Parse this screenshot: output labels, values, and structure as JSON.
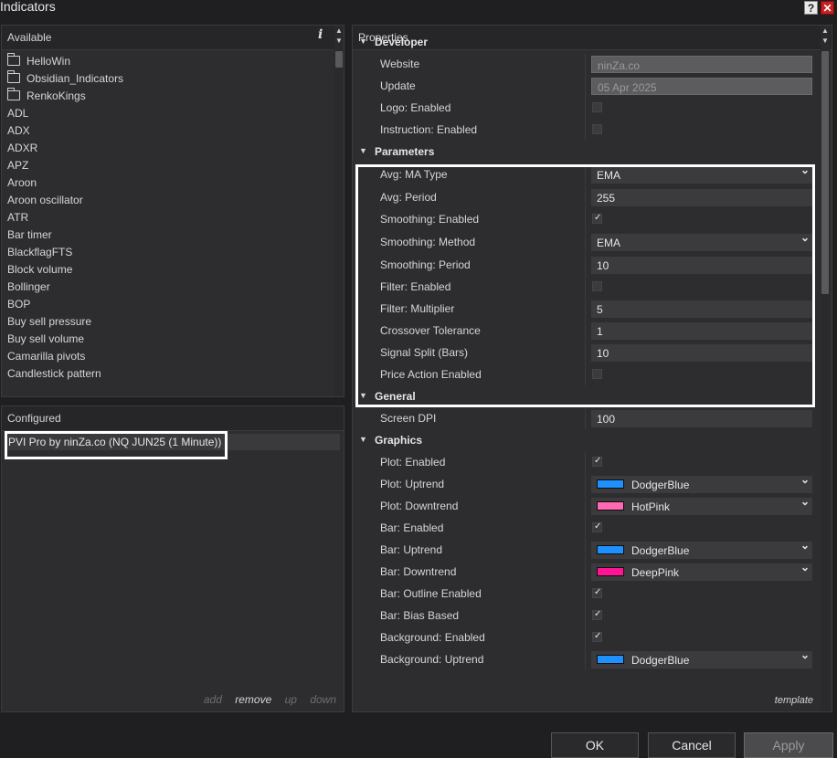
{
  "window": {
    "title": "Indicators",
    "help": "?",
    "close": "✕"
  },
  "available": {
    "header": "Available",
    "info_icon": "i",
    "items": [
      {
        "label": "HelloWin",
        "folder": true
      },
      {
        "label": "Obsidian_Indicators",
        "folder": true
      },
      {
        "label": "RenkoKings",
        "folder": true
      },
      {
        "label": "ADL"
      },
      {
        "label": "ADX"
      },
      {
        "label": "ADXR"
      },
      {
        "label": "APZ"
      },
      {
        "label": "Aroon"
      },
      {
        "label": "Aroon oscillator"
      },
      {
        "label": "ATR"
      },
      {
        "label": "Bar timer"
      },
      {
        "label": "BlackflagFTS"
      },
      {
        "label": "Block volume"
      },
      {
        "label": "Bollinger"
      },
      {
        "label": "BOP"
      },
      {
        "label": "Buy sell pressure"
      },
      {
        "label": "Buy sell volume"
      },
      {
        "label": "Camarilla pivots"
      },
      {
        "label": "Candlestick pattern"
      }
    ]
  },
  "configured": {
    "header": "Configured",
    "item": "PVI Pro by ninZa.co (NQ JUN25 (1 Minute))",
    "actions": {
      "add": "add",
      "remove": "remove",
      "up": "up",
      "down": "down"
    }
  },
  "properties": {
    "header": "Properties",
    "template": "template",
    "categories": {
      "developer": "Developer",
      "parameters": "Parameters",
      "general": "General",
      "graphics": "Graphics"
    },
    "rows": {
      "website": {
        "name": "Website",
        "value": "ninZa.co"
      },
      "update": {
        "name": "Update",
        "value": "05 Apr 2025"
      },
      "logo_enabled": {
        "name": "Logo: Enabled",
        "checked": false
      },
      "instruction_enabled": {
        "name": "Instruction: Enabled",
        "checked": false
      },
      "avg_ma_type": {
        "name": "Avg: MA Type",
        "value": "EMA"
      },
      "avg_period": {
        "name": "Avg: Period",
        "value": "255"
      },
      "smoothing_enabled": {
        "name": "Smoothing: Enabled",
        "checked": true
      },
      "smoothing_method": {
        "name": "Smoothing: Method",
        "value": "EMA"
      },
      "smoothing_period": {
        "name": "Smoothing: Period",
        "value": "10"
      },
      "filter_enabled": {
        "name": "Filter: Enabled",
        "checked": false
      },
      "filter_multiplier": {
        "name": "Filter: Multiplier",
        "value": "5"
      },
      "crossover_tolerance": {
        "name": "Crossover Tolerance",
        "value": "1"
      },
      "signal_split": {
        "name": "Signal Split (Bars)",
        "value": "10"
      },
      "price_action_enabled": {
        "name": "Price Action Enabled",
        "checked": false
      },
      "screen_dpi": {
        "name": "Screen DPI",
        "value": "100"
      },
      "plot_enabled": {
        "name": "Plot: Enabled",
        "checked": true
      },
      "plot_uptrend": {
        "name": "Plot: Uptrend",
        "value": "DodgerBlue",
        "color": "#1e90ff"
      },
      "plot_downtrend": {
        "name": "Plot: Downtrend",
        "value": "HotPink",
        "color": "#ff69b4"
      },
      "bar_enabled": {
        "name": "Bar: Enabled",
        "checked": true
      },
      "bar_uptrend": {
        "name": "Bar: Uptrend",
        "value": "DodgerBlue",
        "color": "#1e90ff"
      },
      "bar_downtrend": {
        "name": "Bar: Downtrend",
        "value": "DeepPink",
        "color": "#ff1493"
      },
      "bar_outline_enabled": {
        "name": "Bar: Outline Enabled",
        "checked": true
      },
      "bar_bias_based": {
        "name": "Bar: Bias Based",
        "checked": true
      },
      "background_enabled": {
        "name": "Background: Enabled",
        "checked": true
      },
      "background_uptrend": {
        "name": "Background: Uptrend",
        "value": "DodgerBlue",
        "color": "#1e90ff"
      }
    }
  },
  "buttons": {
    "ok": "OK",
    "cancel": "Cancel",
    "apply": "Apply"
  },
  "icons": {
    "collapse": "chevron-down-icon",
    "dropdown": "chevron-down-icon",
    "check": "check-icon",
    "folder": "folder-icon"
  }
}
